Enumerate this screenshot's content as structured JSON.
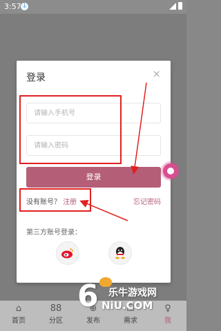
{
  "status": {
    "time": "3:57",
    "download_glyph": "↓"
  },
  "dialog": {
    "title": "登录",
    "close_glyph": "×",
    "phone_placeholder": "请输入手机号",
    "password_placeholder": "请输入密码",
    "login_label": "登录",
    "no_account": "没有账号？",
    "register": "注册",
    "forgot": "忘记密码",
    "third_party": "第三方账号登录："
  },
  "tabs": [
    "首页",
    "分区",
    "发布",
    "需求",
    "我"
  ],
  "tab_icons": [
    "⌂",
    "88",
    "⊕",
    "☐",
    "♀"
  ],
  "watermark": {
    "number": "6",
    "brand": "乐牛游戏网",
    "site": "NiU.COM"
  },
  "colors": {
    "accent": "#b45e78",
    "annotation": "#e02020"
  }
}
